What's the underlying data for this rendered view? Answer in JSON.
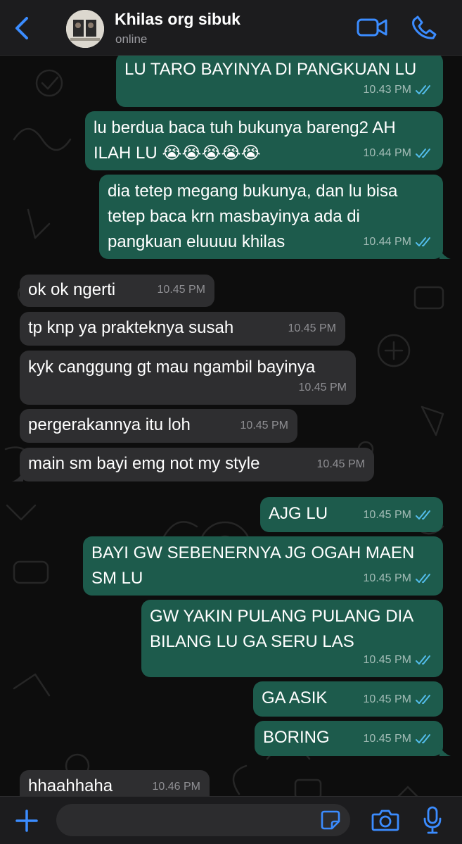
{
  "header": {
    "contact_name": "Khilas org sibuk",
    "status": "online",
    "icons": [
      "back-chevron-icon",
      "video-call-icon",
      "phone-call-icon"
    ]
  },
  "colors": {
    "accent": "#3b8cff",
    "outgoing_bubble": "#1d5b4c",
    "incoming_bubble": "#2e2e30",
    "read_ticks": "#53bdeb"
  },
  "messages": [
    {
      "direction": "out",
      "text": "LU TARO BAYINYA DI PANGKUAN LU",
      "time": "10.43 PM",
      "read": true
    },
    {
      "direction": "out",
      "text": "lu berdua baca tuh bukunya bareng2 AH ILAH LU 😭😭😭😭😭",
      "time": "10.44 PM",
      "read": true
    },
    {
      "direction": "out",
      "text": "dia tetep megang bukunya, dan lu bisa tetep baca krn masbayinya ada di pangkuan eluuuu khilas",
      "time": "10.44 PM",
      "read": true
    },
    {
      "direction": "in",
      "text": "ok ok ngerti",
      "time": "10.45 PM"
    },
    {
      "direction": "in",
      "text": "tp knp ya prakteknya susah",
      "time": "10.45 PM"
    },
    {
      "direction": "in",
      "text": "kyk canggung gt mau ngambil bayinya",
      "time": "10.45 PM"
    },
    {
      "direction": "in",
      "text": "pergerakannya itu loh",
      "time": "10.45 PM"
    },
    {
      "direction": "in",
      "text": "main sm bayi emg not my style",
      "time": "10.45 PM"
    },
    {
      "direction": "out",
      "text": "AJG LU",
      "time": "10.45 PM",
      "read": true
    },
    {
      "direction": "out",
      "text": "BAYI GW SEBENERNYA JG OGAH MAEN SM LU",
      "time": "10.45 PM",
      "read": true
    },
    {
      "direction": "out",
      "text": "GW YAKIN PULANG PULANG DIA BILANG LU GA SERU LAS",
      "time": "10.45 PM",
      "read": true
    },
    {
      "direction": "out",
      "text": "GA ASIK",
      "time": "10.45 PM",
      "read": true
    },
    {
      "direction": "out",
      "text": "BORING",
      "time": "10.45 PM",
      "read": true
    },
    {
      "direction": "in",
      "text": "hhaahhaha",
      "time": "10.46 PM"
    }
  ],
  "input_bar": {
    "placeholder": "",
    "icons": [
      "plus-icon",
      "sticker-icon",
      "camera-icon",
      "microphone-icon"
    ]
  },
  "emoji": {
    "loudly_crying": "😭"
  }
}
